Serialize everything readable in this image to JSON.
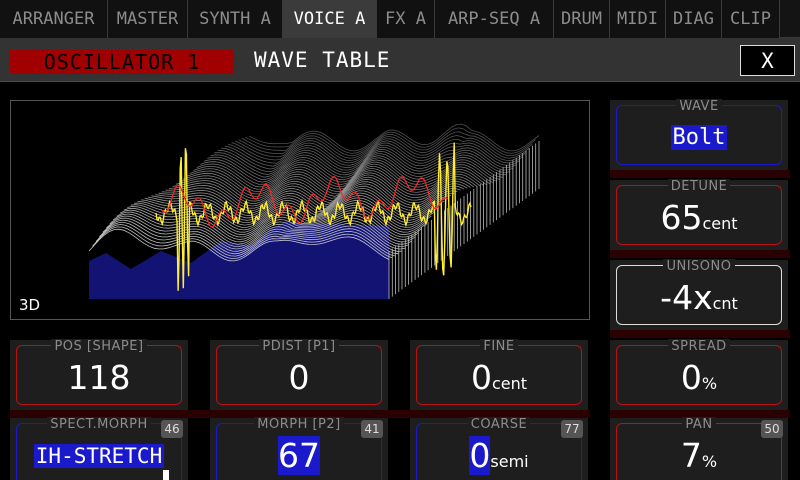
{
  "tabs": [
    {
      "label": "ARRANGER",
      "active": false
    },
    {
      "label": "MASTER",
      "active": false
    },
    {
      "label": "SYNTH A",
      "active": false
    },
    {
      "label": "VOICE A",
      "active": true
    },
    {
      "label": "FX A",
      "active": false
    },
    {
      "label": "ARP-SEQ A",
      "active": false
    },
    {
      "label": "DRUM",
      "active": false
    },
    {
      "label": "MIDI",
      "active": false
    },
    {
      "label": "DIAG",
      "active": false
    },
    {
      "label": "CLIP",
      "active": false
    }
  ],
  "header": {
    "oscillator": "OSCILLATOR 1",
    "title": "WAVE TABLE",
    "close": "X"
  },
  "display": {
    "mode_label": "3D"
  },
  "params": {
    "wave": {
      "label": "WAVE",
      "value": "Bolt"
    },
    "detune": {
      "label": "DETUNE",
      "value": "65",
      "unit": "cent"
    },
    "unisono": {
      "label": "UNISONO",
      "value": "-4x",
      "unit": "cnt"
    },
    "spread": {
      "label": "SPREAD",
      "value": "0",
      "unit": "%"
    },
    "pan": {
      "label": "PAN",
      "value": "7",
      "unit": "%",
      "badge": "50"
    },
    "pos": {
      "label": "POS [SHAPE]",
      "value": "118"
    },
    "pdist": {
      "label": "PDIST [P1]",
      "value": "0"
    },
    "fine": {
      "label": "FINE",
      "value": "0",
      "unit": "cent"
    },
    "spect_morph": {
      "label": "SPECT.MORPH",
      "value": "IH-STRETCH",
      "badge": "46"
    },
    "morph": {
      "label": "MORPH [P2]",
      "value": "67",
      "badge": "41"
    },
    "coarse": {
      "label": "COARSE",
      "value": "0",
      "unit": "semi",
      "badge": "77"
    }
  },
  "colors": {
    "accent_red": "#bb1111",
    "accent_blue": "#1a1acc",
    "badge_red": "#a00000",
    "trace_yellow": "#ffee33",
    "trace_red": "#ff2222",
    "fill_blue": "#14147a"
  }
}
